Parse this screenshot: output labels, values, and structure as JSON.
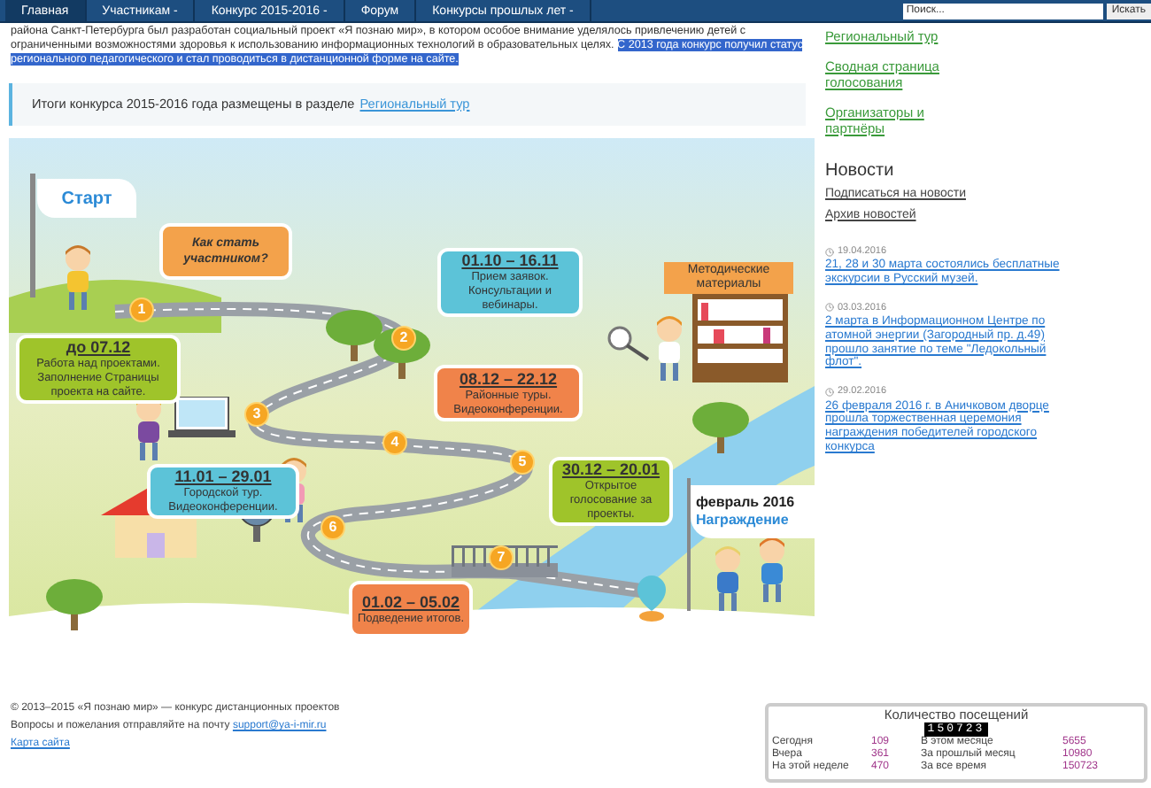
{
  "nav": {
    "items": [
      {
        "label": "Главная",
        "selected": true
      },
      {
        "label": "Участникам -",
        "selected": false
      },
      {
        "label": "Конкурс 2015-2016 -",
        "selected": false
      },
      {
        "label": "Форум",
        "selected": false
      },
      {
        "label": "Конкурсы прошлых лет -",
        "selected": false
      }
    ],
    "search": {
      "placeholder": "Поиск...",
      "button": "Искать"
    }
  },
  "intro": [
    {
      "text": "района Санкт-Петербурга был разработан социальный проект «Я познаю мир», в котором особое внимание уделялось привлечению детей с ограниченными возможностями здоровья к использованию информационных технологий в образовательных целях. ",
      "highlighted": false
    },
    {
      "text": "С 2013 года конкурс получил статус регионального педагогического и стал проводиться в дистанционной форме на сайте.",
      "highlighted": true
    }
  ],
  "notice": {
    "text": "Итоги конкурса 2015-2016 года размещены в разделе",
    "link": "Региональный тур"
  },
  "infographic": {
    "start_flag": "Старт",
    "materials": "Методические материалы",
    "finish_date": "февраль 2016",
    "finish_label": "Награждение",
    "steps": [
      {
        "number": "1",
        "kind": "question",
        "text": "Как стать участником?",
        "color": "#f3a24b"
      },
      {
        "number": "2",
        "kind": "stage",
        "date": "01.10 – 16.11",
        "text": "Прием заявок. Консультации и вебинары.",
        "color": "#5cc3d8"
      },
      {
        "number": "3",
        "kind": "stage",
        "date": "до 07.12",
        "text": "Работа над проектами. Заполнение Страницы проекта на сайте.",
        "color": "#9fc42a"
      },
      {
        "number": "4",
        "kind": "stage",
        "date": "08.12 – 22.12",
        "text": "Районные туры. Видеоконференции.",
        "color": "#f0834a"
      },
      {
        "number": "6",
        "kind": "stage",
        "date": "11.01 – 29.01",
        "text": "Городской тур. Видеоконференции.",
        "color": "#5cc3d8"
      },
      {
        "number": "5",
        "kind": "stage",
        "date": "30.12 – 20.01",
        "text": "Открытое голосование за проекты.",
        "color": "#9fc42a"
      },
      {
        "number": "7",
        "kind": "stage",
        "date": "01.02 – 05.02",
        "text": "Подведение итогов.",
        "color": "#f0834a"
      }
    ]
  },
  "footer": {
    "copyright": "© 2013–2015 «Я познаю мир» — конкурс дистанционных проектов",
    "contact": "Вопросы и пожелания отправляйте на почту",
    "email": "support@ya-i-mir.ru",
    "sitemap": "Карта сайта"
  },
  "sidebar": {
    "links": [
      "Региональный тур",
      "Сводная страница голосования",
      "Организаторы и партнёры"
    ],
    "news_title": "Новости",
    "subscribe": "Подписаться на новости",
    "archive": "Архив новостей",
    "news": [
      {
        "date": "19.04.2016",
        "title": "21, 28 и 30 марта состоялись бесплатные экскурсии в Русский музей."
      },
      {
        "date": "03.03.2016",
        "title": "2 марта в Информационном Центре по атомной энергии (Загородный пр. д.49) прошло занятие по теме \"Ледокольный флот\"."
      },
      {
        "date": "29.02.2016",
        "title": "26 февраля 2016 г. в Аничковом дворце прошла торжественная церемония награждения победителей городского конкурса"
      }
    ]
  },
  "counter": {
    "title": "Количество посещений",
    "total": "150723",
    "rows": [
      {
        "label": "Сегодня",
        "value": "109"
      },
      {
        "label": "Вчера",
        "value": "361"
      },
      {
        "label": "На этой неделе",
        "value": "470"
      },
      {
        "label": "В этом месяце",
        "value": "5655"
      },
      {
        "label": "За прошлый месяц",
        "value": "10980"
      },
      {
        "label": "За все время",
        "value": "150723"
      }
    ]
  }
}
